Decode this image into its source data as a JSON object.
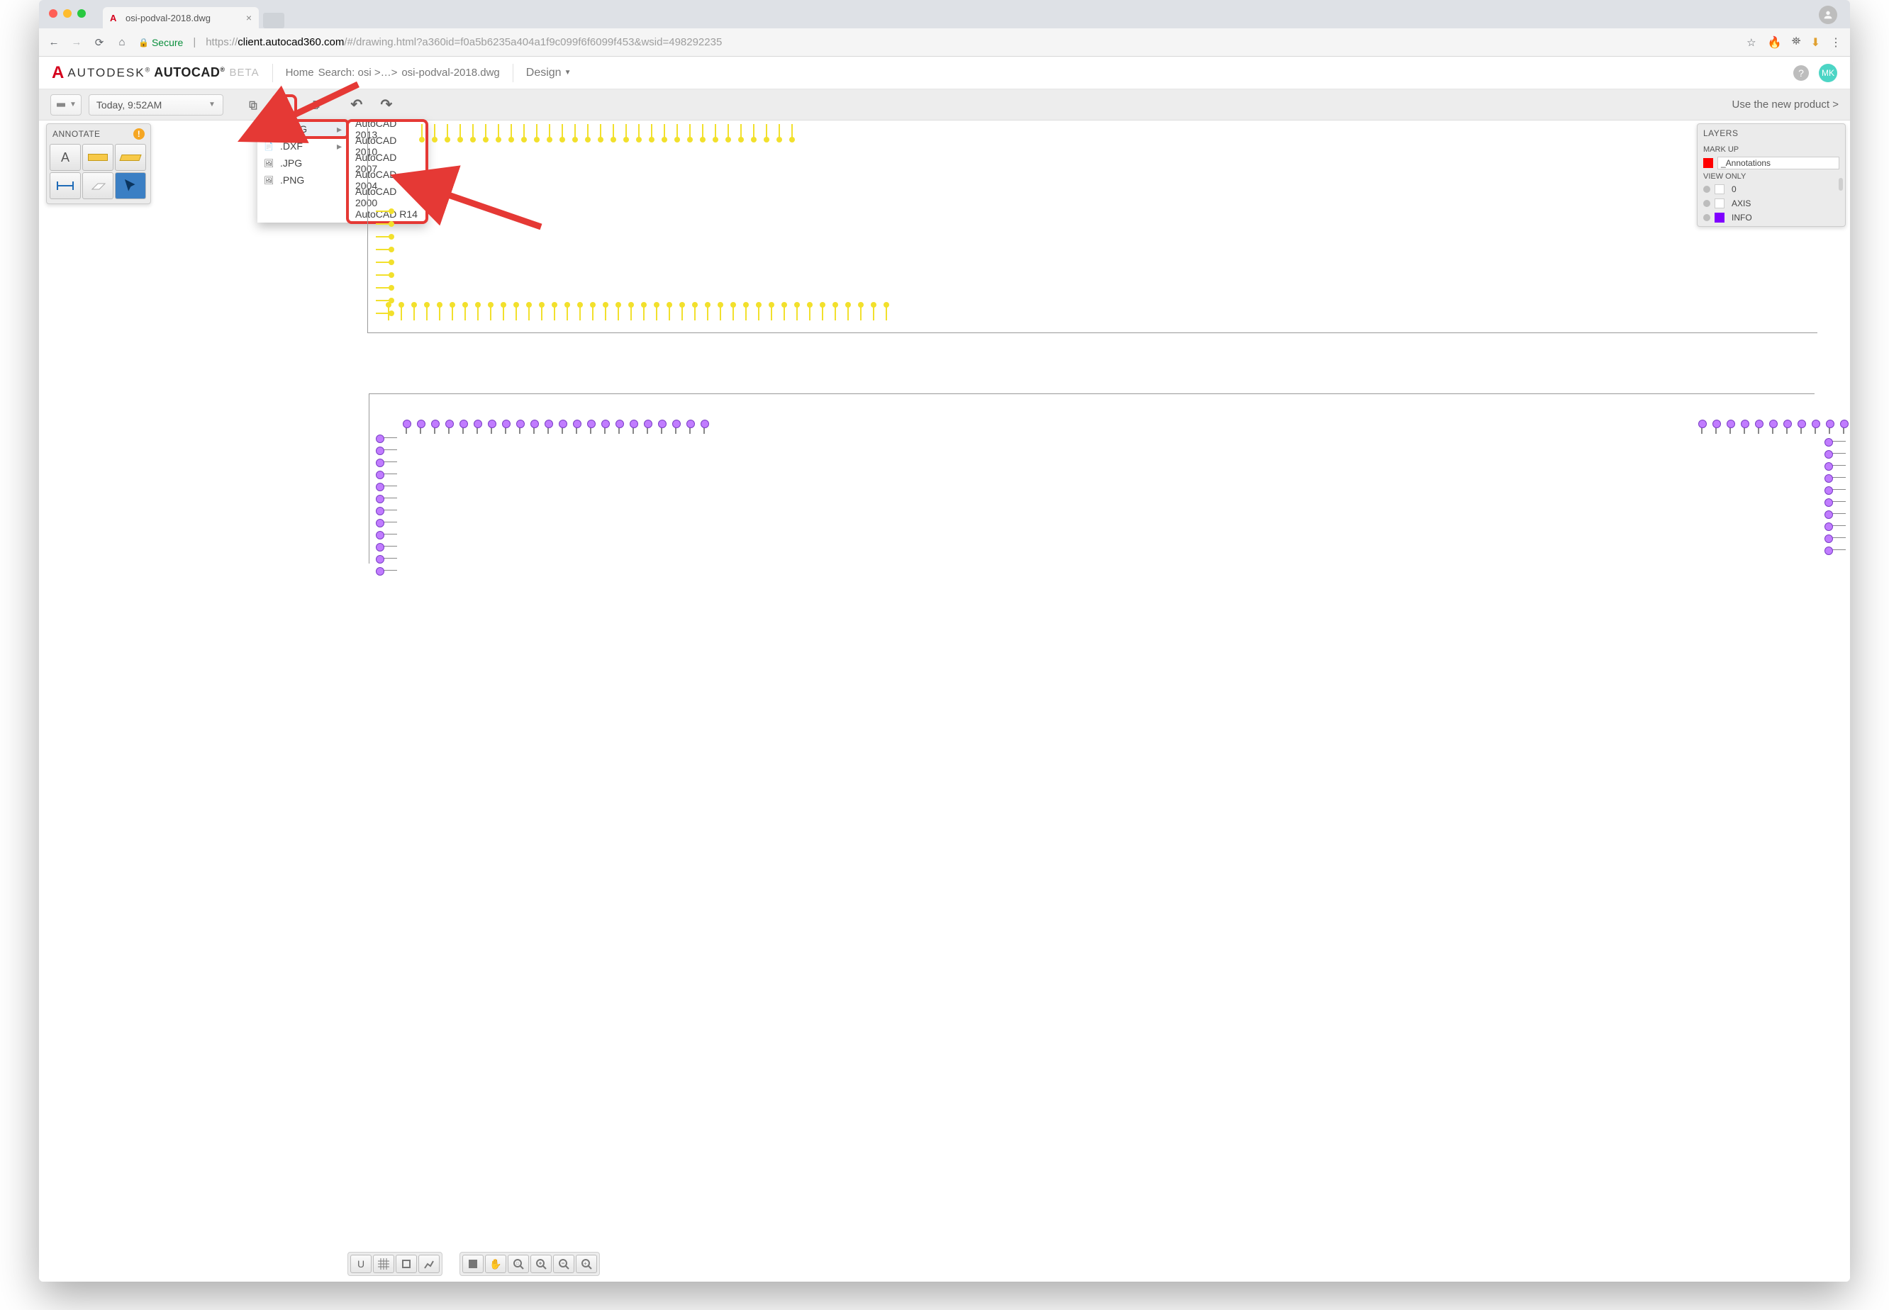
{
  "browser": {
    "tab_title": "osi-podval-2018.dwg",
    "secure_label": "Secure",
    "url_prefix": "https://",
    "url_host": "client.autocad360.com",
    "url_rest": "/#/drawing.html?a360id=f0a5b6235a404a1f9c099f6f6099f453&wsid=498292235"
  },
  "header": {
    "brand_autodesk": "AUTODESK",
    "brand_autocad": "AUTOCAD",
    "brand_beta": "BETA",
    "breadcrumb": [
      "Home",
      "Search: osi >…>",
      "osi-podval-2018.dwg"
    ],
    "mode_label": "Design",
    "avatar_initials": "MK"
  },
  "toolbar": {
    "version_label": "Today, 9:52AM",
    "new_product_label": "Use the new product >"
  },
  "download_menu": {
    "formats": [
      ".DWG",
      ".DXF",
      ".JPG",
      ".PNG"
    ],
    "dwg_versions": [
      "AutoCAD 2013",
      "AutoCAD 2010",
      "AutoCAD 2007",
      "AutoCAD 2004",
      "AutoCAD 2000",
      "AutoCAD R14"
    ]
  },
  "annotate": {
    "title": "ANNOTATE"
  },
  "layers": {
    "title": "LAYERS",
    "section_markup": "MARK UP",
    "section_viewonly": "VIEW ONLY",
    "markup_rows": [
      {
        "color": "#ff0000",
        "name": "_Annotations"
      }
    ],
    "view_rows": [
      {
        "color": "#ffffff",
        "name": "0"
      },
      {
        "color": "#ffffff",
        "name": "AXIS"
      },
      {
        "color": "#8000ff",
        "name": "INFO"
      }
    ]
  },
  "bottom_tools": {
    "group1": [
      "U",
      "grid",
      "crop",
      "graph"
    ],
    "group2": [
      "extent",
      "pan",
      "zoom-window",
      "zoom-in",
      "zoom-out",
      "zoom-add"
    ]
  }
}
